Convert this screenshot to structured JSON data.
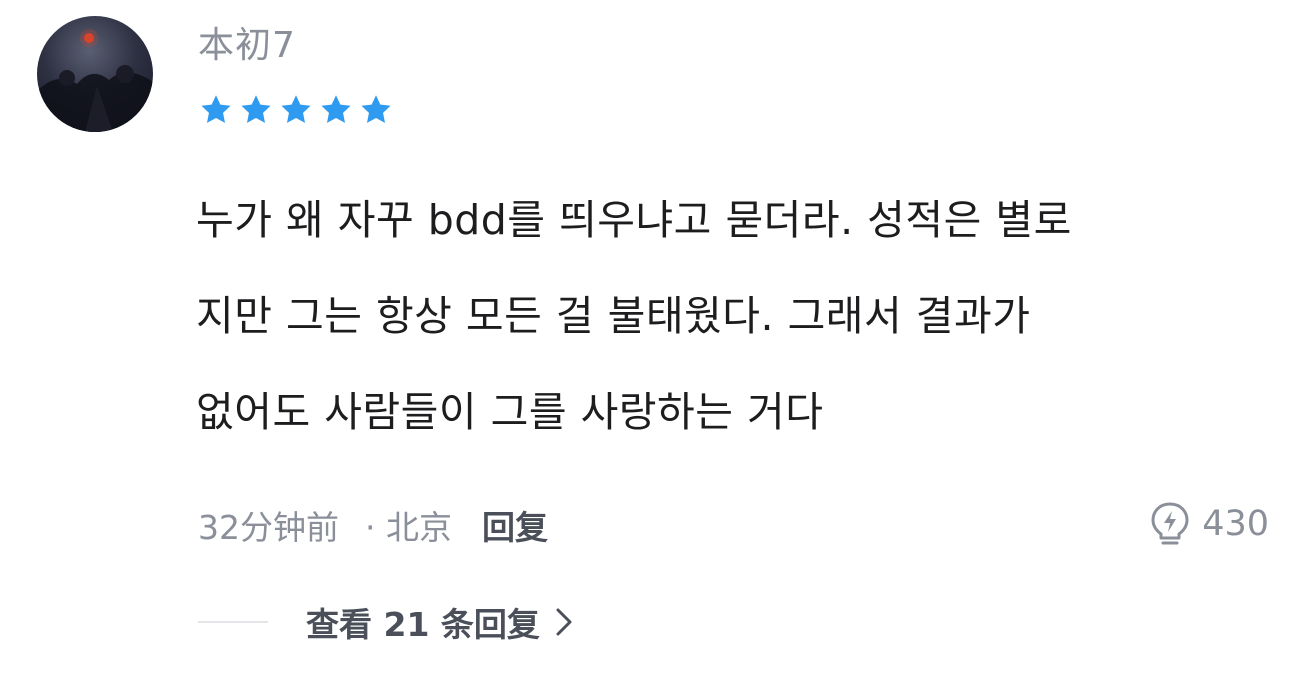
{
  "comment": {
    "username": "本初7",
    "avatar_icon": "user-avatar",
    "rating": {
      "value": 5,
      "max": 5,
      "icon": "star-icon",
      "color": "#2e9af0"
    },
    "body_lines": [
      "누가 왜 자꾸 bdd를 띄우냐고 묻더라. 성적은 별로",
      "지만 그는 항상 모든 걸 불태웠다. 그래서 결과가",
      "없어도 사람들이 그를 사랑하는 거다"
    ],
    "time": "32分钟前",
    "location": "· 北京",
    "reply_label": "回复",
    "likes": {
      "icon": "lightbulb-icon",
      "count": "430"
    },
    "view_replies": {
      "label": "查看 21 条回复",
      "icon": "chevron-right-icon"
    }
  }
}
